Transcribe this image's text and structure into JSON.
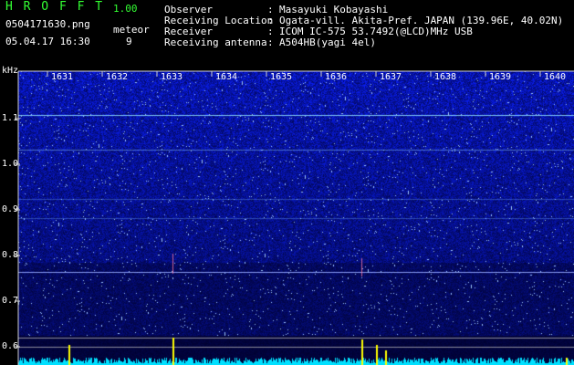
{
  "header": {
    "app_name": "H R O F F T",
    "version": "1.00",
    "filename": "0504171630.png",
    "datetime": "05.04.17 16:30",
    "meteor_label": "meteor",
    "meteor_count": "9",
    "fields": [
      {
        "label": "Observer",
        "sep": ":",
        "value": "Masayuki Kobayashi"
      },
      {
        "label": "Receiving Location",
        "sep": ":",
        "value": "Ogata-vill. Akita-Pref. JAPAN (139.96E, 40.02N)"
      },
      {
        "label": "Receiver",
        "sep": ":",
        "value": "ICOM IC-575 53.7492(@LCD)MHz USB"
      },
      {
        "label": "Receiving antenna",
        "sep": ":",
        "value": "A504HB(yagi 4el)"
      }
    ]
  },
  "chart_data": {
    "type": "heatmap",
    "ylabel": "kHz",
    "y_ticks": [
      "1.1",
      "1.0",
      "0.9",
      "0.8",
      "0.7",
      "0.6"
    ],
    "x_ticks": [
      "1631",
      "1632",
      "1633",
      "1634",
      "1635",
      "1636",
      "1637",
      "1638",
      "1639",
      "1640"
    ],
    "colors": {
      "background": "#000000",
      "noise": "#1a2fd0",
      "line": "#8fd8ff",
      "meteor": "#ffff00",
      "baseline": "#00e0ff"
    }
  }
}
